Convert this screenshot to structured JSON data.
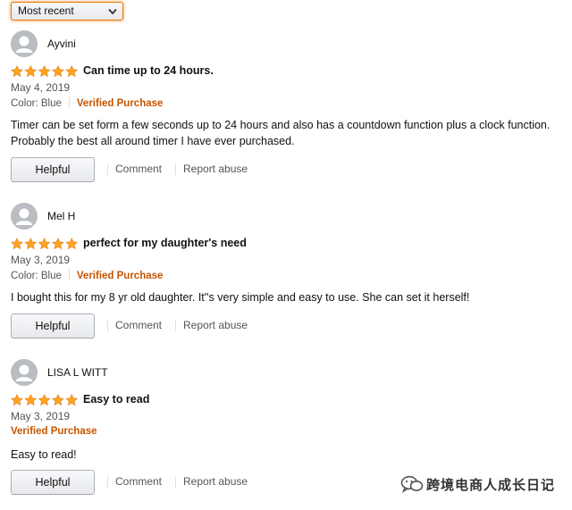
{
  "sort": {
    "selected": "Most recent"
  },
  "reviews": [
    {
      "reviewer": "Ayvini",
      "rating": 5,
      "title": "Can time up to 24 hours.",
      "date": "May 4, 2019",
      "color": "Color: Blue",
      "verified": "Verified Purchase",
      "body": "Timer can be set form a few seconds up to 24 hours and also has a countdown function plus a clock function. Probably the best all around timer I have ever purchased."
    },
    {
      "reviewer": "Mel H",
      "rating": 5,
      "title": "perfect for my daughter's need",
      "date": "May 3, 2019",
      "color": "Color: Blue",
      "verified": "Verified Purchase",
      "body": "I bought this for my 8 yr old daughter. It''s very simple and easy to use. She can set it herself!"
    },
    {
      "reviewer": "LISA L WITT",
      "rating": 5,
      "title": "Easy to read",
      "date": "May 3, 2019",
      "color": "",
      "verified": "Verified Purchase",
      "body": "Easy to read!"
    }
  ],
  "actions": {
    "helpful": "Helpful",
    "comment": "Comment",
    "report": "Report abuse"
  },
  "watermark": {
    "text": "跨境电商人成长日记",
    "icon": "wechat-icon"
  },
  "colors": {
    "star": "#ffa41c",
    "verified": "#c45500",
    "focus": "#e77600"
  }
}
